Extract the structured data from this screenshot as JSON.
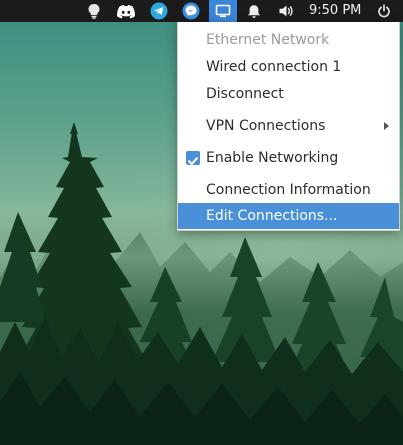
{
  "panel": {
    "clock": "9:50 PM",
    "tray_icons": [
      "lightbulb-icon",
      "discord-icon",
      "telegram-icon",
      "messenger-icon",
      "network-icon",
      "notification-bell-icon",
      "volume-icon",
      "power-icon"
    ],
    "panel_color": "#1b1b1b",
    "active_tray_color": "#3b86d8"
  },
  "network_menu": {
    "section_header": "Ethernet Network",
    "connection_name": "Wired connection 1",
    "disconnect_label": "Disconnect",
    "vpn_label": "VPN Connections",
    "enable_networking_label": "Enable Networking",
    "enable_networking_checked": true,
    "connection_info_label": "Connection Information",
    "edit_connections_label": "Edit Connections...",
    "highlight_color": "#4a90d9"
  }
}
